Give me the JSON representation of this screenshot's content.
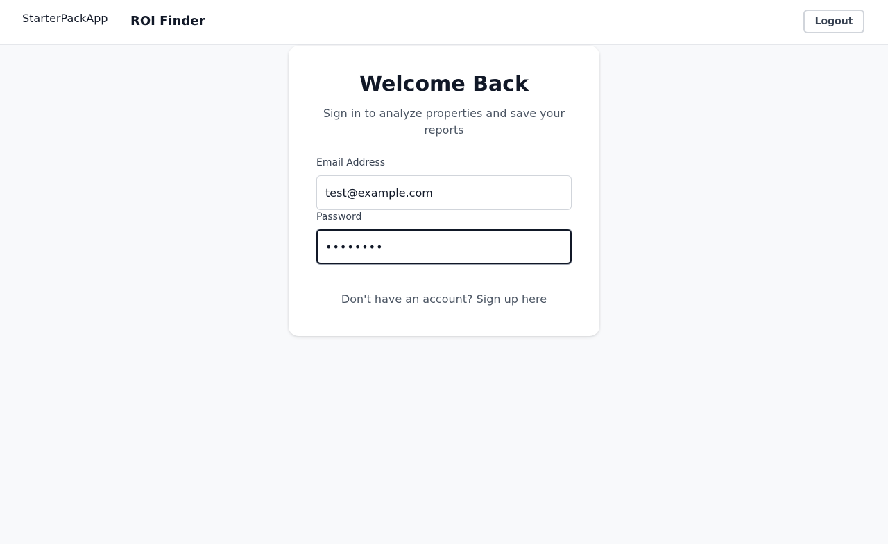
{
  "header": {
    "logo_alt": "StarterPackApp",
    "title": "ROI Finder",
    "logout_label": "Logout"
  },
  "login": {
    "title": "Welcome Back",
    "subtitle": "Sign in to analyze properties and save your reports",
    "email_label": "Email Address",
    "email_value": "test@example.com",
    "password_label": "Password",
    "password_value": "••••••••",
    "signup_prompt": "Don't have an account?",
    "signup_link": "Sign up here"
  },
  "colors": {
    "page_background": "#f8f9fb",
    "card_background": "#ffffff",
    "text_primary": "#111827",
    "text_secondary": "#4b5563",
    "border": "#d1d5db",
    "focus_border": "#111827"
  }
}
